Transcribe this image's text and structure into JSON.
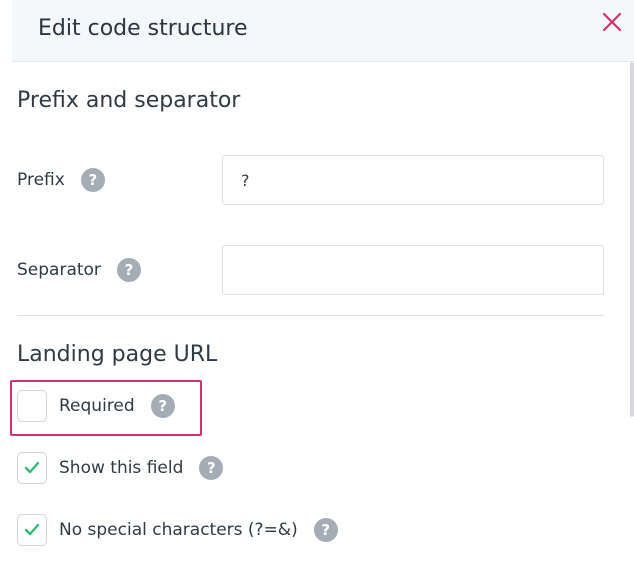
{
  "header": {
    "title": "Edit code structure"
  },
  "sections": {
    "prefix_separator": {
      "title": "Prefix and separator",
      "prefix_label": "Prefix",
      "prefix_value": "?",
      "separator_label": "Separator",
      "separator_value": ""
    },
    "landing_page": {
      "title": "Landing page URL",
      "options": [
        {
          "label": "Required",
          "checked": false
        },
        {
          "label": "Show this field",
          "checked": true
        },
        {
          "label": "No special characters (?=&)",
          "checked": true
        }
      ]
    }
  },
  "help_glyph": "?",
  "icons": {
    "close": "close-icon",
    "help": "help-icon",
    "check": "checkmark-icon"
  },
  "colors": {
    "accent_close": "#d3306f",
    "highlight": "#d3306f",
    "check": "#33b97a",
    "help_bg": "#a4acb6"
  }
}
